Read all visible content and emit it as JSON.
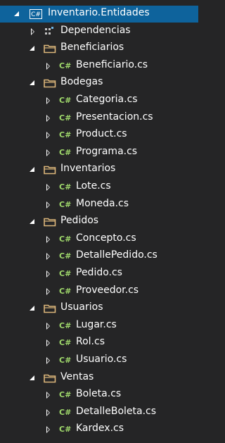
{
  "project": {
    "name": "Inventario.Entidades",
    "icon": "csharp-project-icon"
  },
  "items": [
    {
      "name": "Dependencias",
      "kind": "dependencies",
      "icon": "dependencies-icon",
      "expanded": false,
      "depth": 1
    },
    {
      "name": "Beneficiarios",
      "kind": "folder",
      "icon": "folder-icon",
      "expanded": true,
      "depth": 1
    },
    {
      "name": "Beneficiario.cs",
      "kind": "file",
      "icon": "csharp-file-icon",
      "expanded": false,
      "depth": 2
    },
    {
      "name": "Bodegas",
      "kind": "folder",
      "icon": "folder-icon",
      "expanded": true,
      "depth": 1
    },
    {
      "name": "Categoria.cs",
      "kind": "file",
      "icon": "csharp-file-icon",
      "expanded": false,
      "depth": 2
    },
    {
      "name": "Presentacion.cs",
      "kind": "file",
      "icon": "csharp-file-icon",
      "expanded": false,
      "depth": 2
    },
    {
      "name": "Product.cs",
      "kind": "file",
      "icon": "csharp-file-icon",
      "expanded": false,
      "depth": 2
    },
    {
      "name": "Programa.cs",
      "kind": "file",
      "icon": "csharp-file-icon",
      "expanded": false,
      "depth": 2
    },
    {
      "name": "Inventarios",
      "kind": "folder",
      "icon": "folder-icon",
      "expanded": true,
      "depth": 1
    },
    {
      "name": "Lote.cs",
      "kind": "file",
      "icon": "csharp-file-icon",
      "expanded": false,
      "depth": 2
    },
    {
      "name": "Moneda.cs",
      "kind": "file",
      "icon": "csharp-file-icon",
      "expanded": false,
      "depth": 2
    },
    {
      "name": "Pedidos",
      "kind": "folder",
      "icon": "folder-icon",
      "expanded": true,
      "depth": 1
    },
    {
      "name": "Concepto.cs",
      "kind": "file",
      "icon": "csharp-file-icon",
      "expanded": false,
      "depth": 2
    },
    {
      "name": "DetallePedido.cs",
      "kind": "file",
      "icon": "csharp-file-icon",
      "expanded": false,
      "depth": 2
    },
    {
      "name": "Pedido.cs",
      "kind": "file",
      "icon": "csharp-file-icon",
      "expanded": false,
      "depth": 2
    },
    {
      "name": "Proveedor.cs",
      "kind": "file",
      "icon": "csharp-file-icon",
      "expanded": false,
      "depth": 2
    },
    {
      "name": "Usuarios",
      "kind": "folder",
      "icon": "folder-icon",
      "expanded": true,
      "depth": 1
    },
    {
      "name": "Lugar.cs",
      "kind": "file",
      "icon": "csharp-file-icon",
      "expanded": false,
      "depth": 2
    },
    {
      "name": "Rol.cs",
      "kind": "file",
      "icon": "csharp-file-icon",
      "expanded": false,
      "depth": 2
    },
    {
      "name": "Usuario.cs",
      "kind": "file",
      "icon": "csharp-file-icon",
      "expanded": false,
      "depth": 2
    },
    {
      "name": "Ventas",
      "kind": "folder",
      "icon": "folder-icon",
      "expanded": true,
      "depth": 1
    },
    {
      "name": "Boleta.cs",
      "kind": "file",
      "icon": "csharp-file-icon",
      "expanded": false,
      "depth": 2
    },
    {
      "name": "DetalleBoleta.cs",
      "kind": "file",
      "icon": "csharp-file-icon",
      "expanded": false,
      "depth": 2
    },
    {
      "name": "Kardex.cs",
      "kind": "file",
      "icon": "csharp-file-icon",
      "expanded": false,
      "depth": 2
    }
  ],
  "colors": {
    "background": "#252526",
    "selection": "#0e639c",
    "folder": "#dcb67a",
    "csharp": "#9fd86b",
    "text": "#ffffff"
  }
}
